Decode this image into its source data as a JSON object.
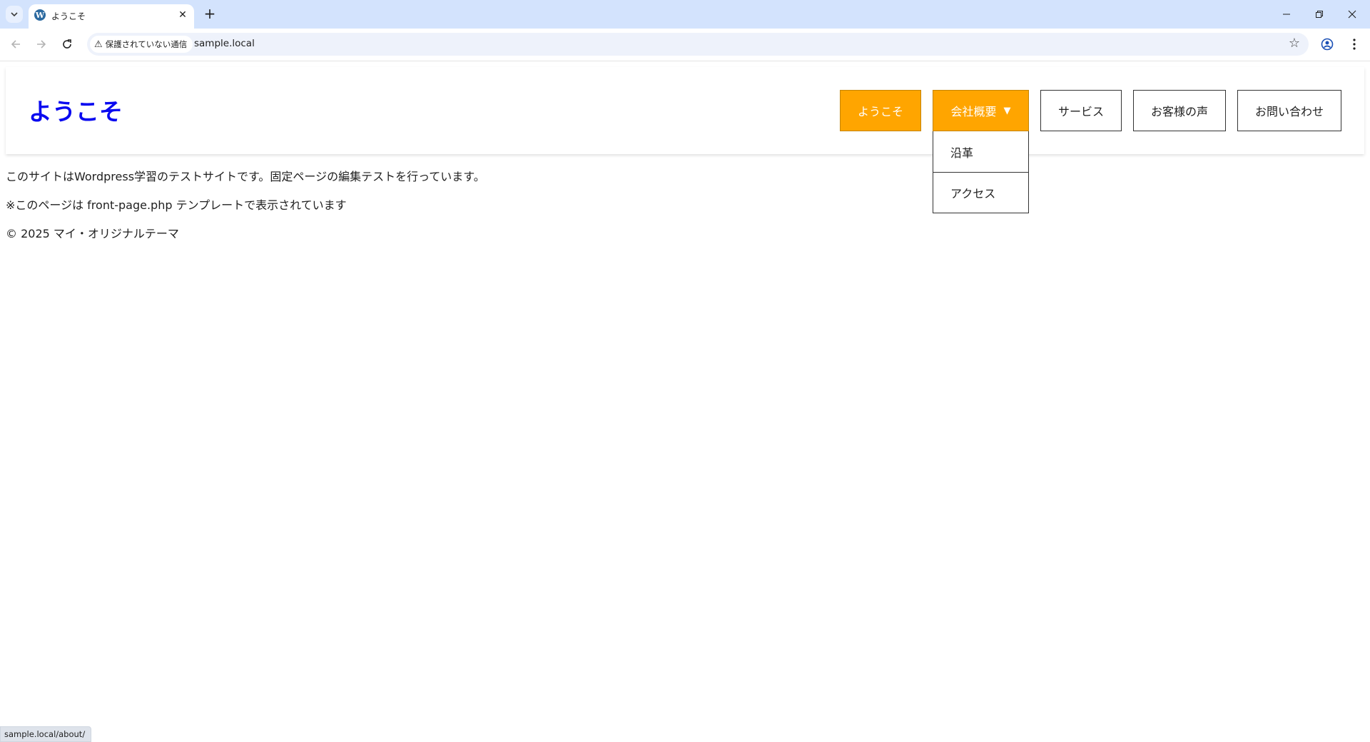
{
  "browser": {
    "tab_title": "ようこそ",
    "favicon_letter": "W",
    "security_label": "保護されていない通信",
    "url": "sample.local",
    "status_url": "sample.local/about/"
  },
  "site": {
    "title": "ようこそ",
    "nav": [
      {
        "label": "ようこそ"
      },
      {
        "label": "会社概要",
        "arrow": "▼"
      },
      {
        "label": "サービス"
      },
      {
        "label": "お客様の声"
      },
      {
        "label": "お問い合わせ"
      }
    ],
    "dropdown": [
      {
        "label": "沿革"
      },
      {
        "label": "アクセス"
      }
    ],
    "content": {
      "paragraph1": "このサイトはWordpress学習のテストサイトです。固定ページの編集テストを行っています。",
      "paragraph2": "※このページは front-page.php テンプレートで表示されています",
      "footer": "© 2025 マイ・オリジナルテーマ"
    }
  },
  "colors": {
    "accent": "#ffa500",
    "title": "#0a0af0"
  }
}
